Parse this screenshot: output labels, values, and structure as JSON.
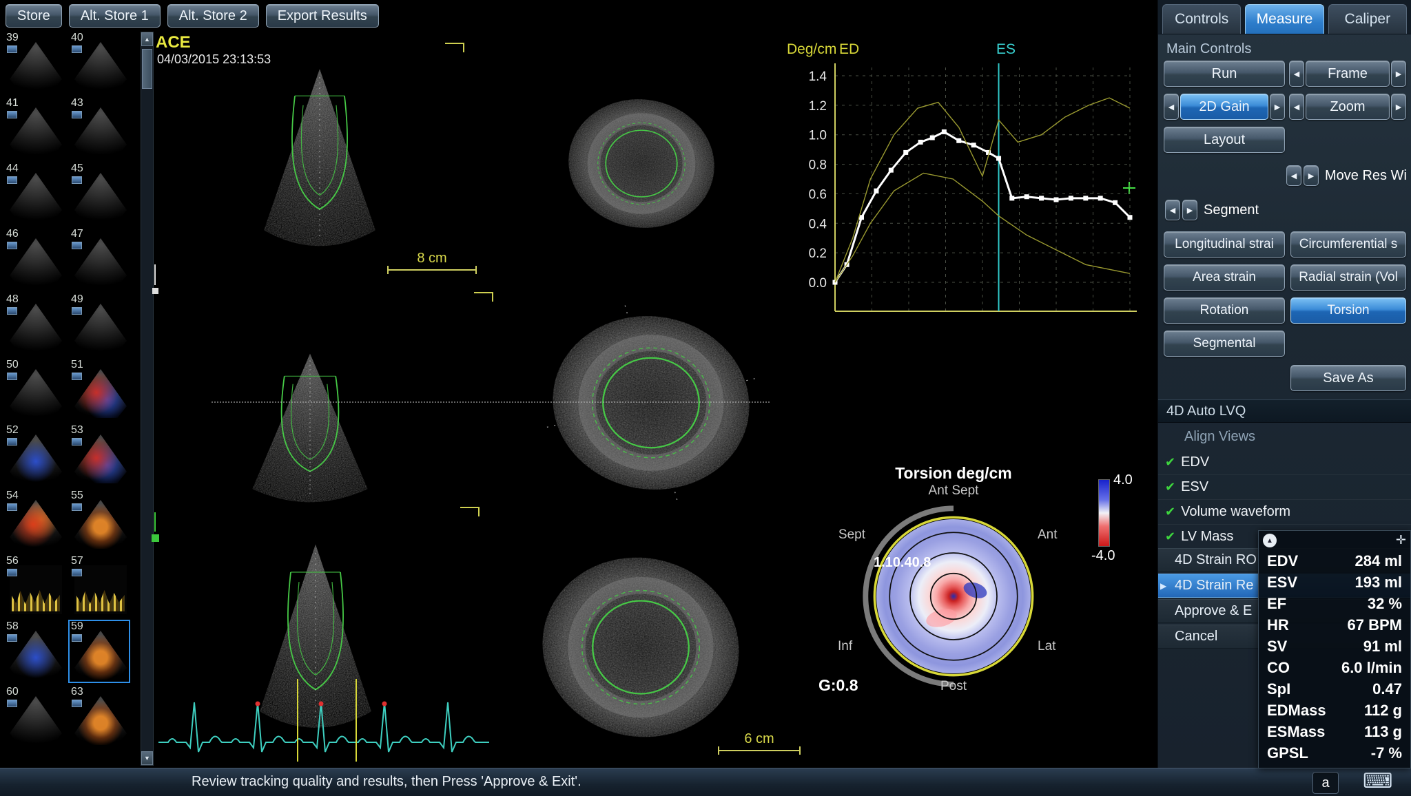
{
  "toolbar": {
    "buttons": [
      "Store",
      "Alt. Store 1",
      "Alt. Store 2",
      "Export Results"
    ]
  },
  "thumbnails": [
    {
      "num": "39",
      "tint": "gray"
    },
    {
      "num": "40",
      "tint": "gray"
    },
    {
      "num": "41",
      "tint": "gray"
    },
    {
      "num": "43",
      "tint": "gray"
    },
    {
      "num": "44",
      "tint": "gray"
    },
    {
      "num": "45",
      "tint": "gray"
    },
    {
      "num": "46",
      "tint": "gray"
    },
    {
      "num": "47",
      "tint": "gray"
    },
    {
      "num": "48",
      "tint": "gray"
    },
    {
      "num": "49",
      "tint": "gray"
    },
    {
      "num": "50",
      "tint": "gray"
    },
    {
      "num": "51",
      "tint": "doppler"
    },
    {
      "num": "52",
      "tint": "blue"
    },
    {
      "num": "53",
      "tint": "doppler"
    },
    {
      "num": "54",
      "tint": "red"
    },
    {
      "num": "55",
      "tint": "orange"
    },
    {
      "num": "56",
      "tint": "spectral"
    },
    {
      "num": "57",
      "tint": "spectral"
    },
    {
      "num": "58",
      "tint": "blue"
    },
    {
      "num": "59",
      "tint": "orange",
      "selected": true
    },
    {
      "num": "60",
      "tint": "gray"
    },
    {
      "num": "63",
      "tint": "orange"
    }
  ],
  "viewport": {
    "logo": "ACE",
    "timestamp": "04/03/2015 23:13:53",
    "ruler_top": "8 cm",
    "ruler_bottom": "6 cm"
  },
  "chart_data": {
    "type": "line",
    "ylabel": "Deg/cm",
    "ed_label": "ED",
    "es_label": "ES",
    "yticks": [
      "1.4",
      "1.2",
      "1.0",
      "0.8",
      "0.6",
      "0.4",
      "0.2",
      "0.0"
    ],
    "ylim": [
      0,
      1.4
    ],
    "es_x": 0.555,
    "grid": true,
    "series": [
      {
        "name": "global torsion",
        "color": "#ffffff",
        "width": 3,
        "markers": true,
        "x": [
          0,
          0.04,
          0.09,
          0.14,
          0.19,
          0.24,
          0.29,
          0.33,
          0.37,
          0.42,
          0.47,
          0.52,
          0.555,
          0.6,
          0.65,
          0.7,
          0.75,
          0.8,
          0.85,
          0.9,
          0.95,
          1.0
        ],
        "y": [
          0.0,
          0.12,
          0.44,
          0.62,
          0.76,
          0.88,
          0.95,
          0.98,
          1.02,
          0.96,
          0.93,
          0.88,
          0.84,
          0.57,
          0.58,
          0.57,
          0.56,
          0.57,
          0.57,
          0.57,
          0.54,
          0.44
        ]
      },
      {
        "name": "band upper",
        "color": "#9a9a30",
        "width": 1.4,
        "markers": false,
        "x": [
          0,
          0.06,
          0.12,
          0.2,
          0.28,
          0.35,
          0.42,
          0.5,
          0.555,
          0.62,
          0.7,
          0.78,
          0.86,
          0.93,
          1.0
        ],
        "y": [
          0.0,
          0.3,
          0.7,
          1.0,
          1.18,
          1.22,
          1.05,
          0.72,
          1.1,
          0.95,
          1.0,
          1.12,
          1.2,
          1.25,
          1.18
        ]
      },
      {
        "name": "band lower",
        "color": "#9a9a30",
        "width": 1.4,
        "markers": false,
        "x": [
          0,
          0.06,
          0.12,
          0.2,
          0.3,
          0.4,
          0.5,
          0.555,
          0.65,
          0.75,
          0.85,
          1.0
        ],
        "y": [
          0.0,
          0.18,
          0.4,
          0.62,
          0.74,
          0.7,
          0.55,
          0.45,
          0.32,
          0.22,
          0.12,
          0.06
        ]
      }
    ]
  },
  "bullseye": {
    "title": "Torsion deg/cm",
    "label_top": "Ant Sept",
    "label_left": "Sept",
    "label_right": "Ant",
    "label_bottom_left": "Inf",
    "label_bottom_right": "Lat",
    "label_bottom": "Post",
    "values": "1.10.40.8",
    "scale_max": "4.0",
    "scale_min": "-4.0",
    "g_label": "G:0.8"
  },
  "right_panel": {
    "tabs": [
      {
        "label": "Controls",
        "active": false
      },
      {
        "label": "Measure",
        "active": true
      },
      {
        "label": "Caliper",
        "active": false
      }
    ],
    "main_controls_label": "Main Controls",
    "run": "Run",
    "frame": "Frame",
    "gain_2d": "2D Gain",
    "zoom": "Zoom",
    "layout": "Layout",
    "move_res": "Move Res Wi",
    "segment": "Segment",
    "strain_buttons": [
      {
        "label": "Longitudinal strai",
        "active": false
      },
      {
        "label": "Circumferential s",
        "active": false
      },
      {
        "label": "Area strain",
        "active": false
      },
      {
        "label": "Radial strain (Vol",
        "active": false
      },
      {
        "label": "Rotation",
        "active": false
      },
      {
        "label": "Torsion",
        "active": true
      },
      {
        "label": "Segmental",
        "active": false
      }
    ],
    "save_as": "Save As",
    "lvq_header": "4D Auto LVQ",
    "align_views": "Align Views",
    "check_items": [
      {
        "label": "EDV"
      },
      {
        "label": "ESV"
      },
      {
        "label": "Volume waveform"
      },
      {
        "label": "LV Mass"
      }
    ],
    "menu_items": [
      {
        "label": "4D Strain RO",
        "selected": false
      },
      {
        "label": "4D Strain Re",
        "selected": true
      },
      {
        "label": "Approve & E",
        "selected": false
      },
      {
        "label": "Cancel",
        "selected": false
      }
    ]
  },
  "results": {
    "rows": [
      {
        "label": "EDV",
        "value": "284 ml"
      },
      {
        "label": "ESV",
        "value": "193 ml"
      },
      {
        "label": "EF",
        "value": "32 %"
      },
      {
        "label": "HR",
        "value": "67 BPM"
      },
      {
        "label": "SV",
        "value": "91 ml"
      },
      {
        "label": "CO",
        "value": "6.0 l/min"
      },
      {
        "label": "SpI",
        "value": "0.47"
      },
      {
        "label": "EDMass",
        "value": "112 g"
      },
      {
        "label": "ESMass",
        "value": "113 g"
      },
      {
        "label": "GPSL",
        "value": "-7 %"
      }
    ]
  },
  "status_bar": {
    "message": "Review tracking quality and results, then Press 'Approve & Exit'.",
    "keyboard_label": "a"
  }
}
